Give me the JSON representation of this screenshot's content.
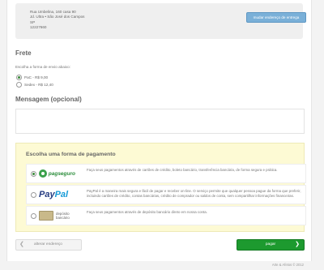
{
  "address": {
    "lines": [
      "Rua Umbelina, 160 casa 90",
      "Jd. Ultra • São José dos Campos",
      "SP",
      "12227660"
    ],
    "change_button": "mudar endereço de entrega"
  },
  "shipping": {
    "title": "Frete",
    "hint": "Escolha a forma de envio abaixo:",
    "options": [
      {
        "label": "PaC - R$ 9,00",
        "selected": true
      },
      {
        "label": "Sedex - R$ 12,40",
        "selected": false
      }
    ]
  },
  "message": {
    "title": "Mensagem (opcional)",
    "value": ""
  },
  "payment": {
    "title": "Escolha uma forma de pagamento",
    "options": [
      {
        "logo_text": "pagseguro",
        "description": "Faça seus pagamentos através de cartões de crédito, boleto bancário, transferência bancária, de forma segura e prática.",
        "selected": true
      },
      {
        "logo_text_1": "Pay",
        "logo_text_2": "Pal",
        "description": "PayPal é a maneira mais segura e fácil de pagar e receber on-line. O serviço permite que qualquer pessoa pague da forma que preferir, incluindo cartões de crédito, contas bancárias, crédito de comprador ou saldos de conta, sem compartilhar informações financeiras.",
        "selected": false
      },
      {
        "logo_text_1": "depósito",
        "logo_text_2": "bancário",
        "description": "Faça seus pagamentos através de depósito bancário direto em nossa conta.",
        "selected": false
      }
    ]
  },
  "actions": {
    "back_label": "alterar endereço",
    "pay_label": "pagar"
  },
  "footer": {
    "credit": "Arte & Afetos © 2012"
  },
  "icons": {
    "back": "chevron-left-icon",
    "pay": "chevron-right-icon"
  },
  "colors": {
    "accent_green": "#1d9a2f",
    "button_blue": "#7ab0d8",
    "payment_panel": "#fdfad4"
  }
}
